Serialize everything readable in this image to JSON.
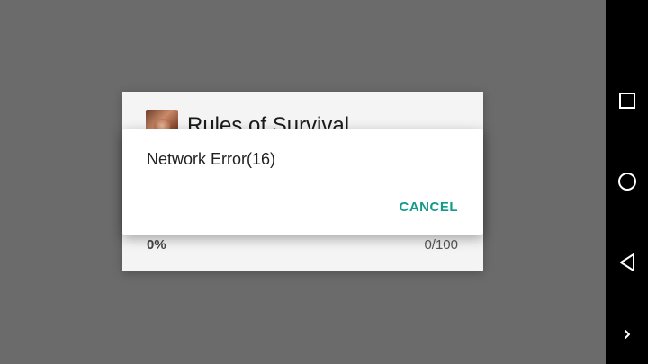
{
  "background_dialog": {
    "app_name": "Rules of Survival",
    "progress_percent_label": "0%",
    "progress_count_label": "0/100"
  },
  "error_dialog": {
    "message": "Network Error(16)",
    "cancel_label": "CANCEL",
    "accent_color": "#129a8a"
  },
  "nav_bar": {
    "buttons": [
      {
        "icon": "square-recents-icon"
      },
      {
        "icon": "circle-home-icon"
      },
      {
        "icon": "triangle-back-icon"
      },
      {
        "icon": "chevron-right-icon"
      }
    ]
  }
}
